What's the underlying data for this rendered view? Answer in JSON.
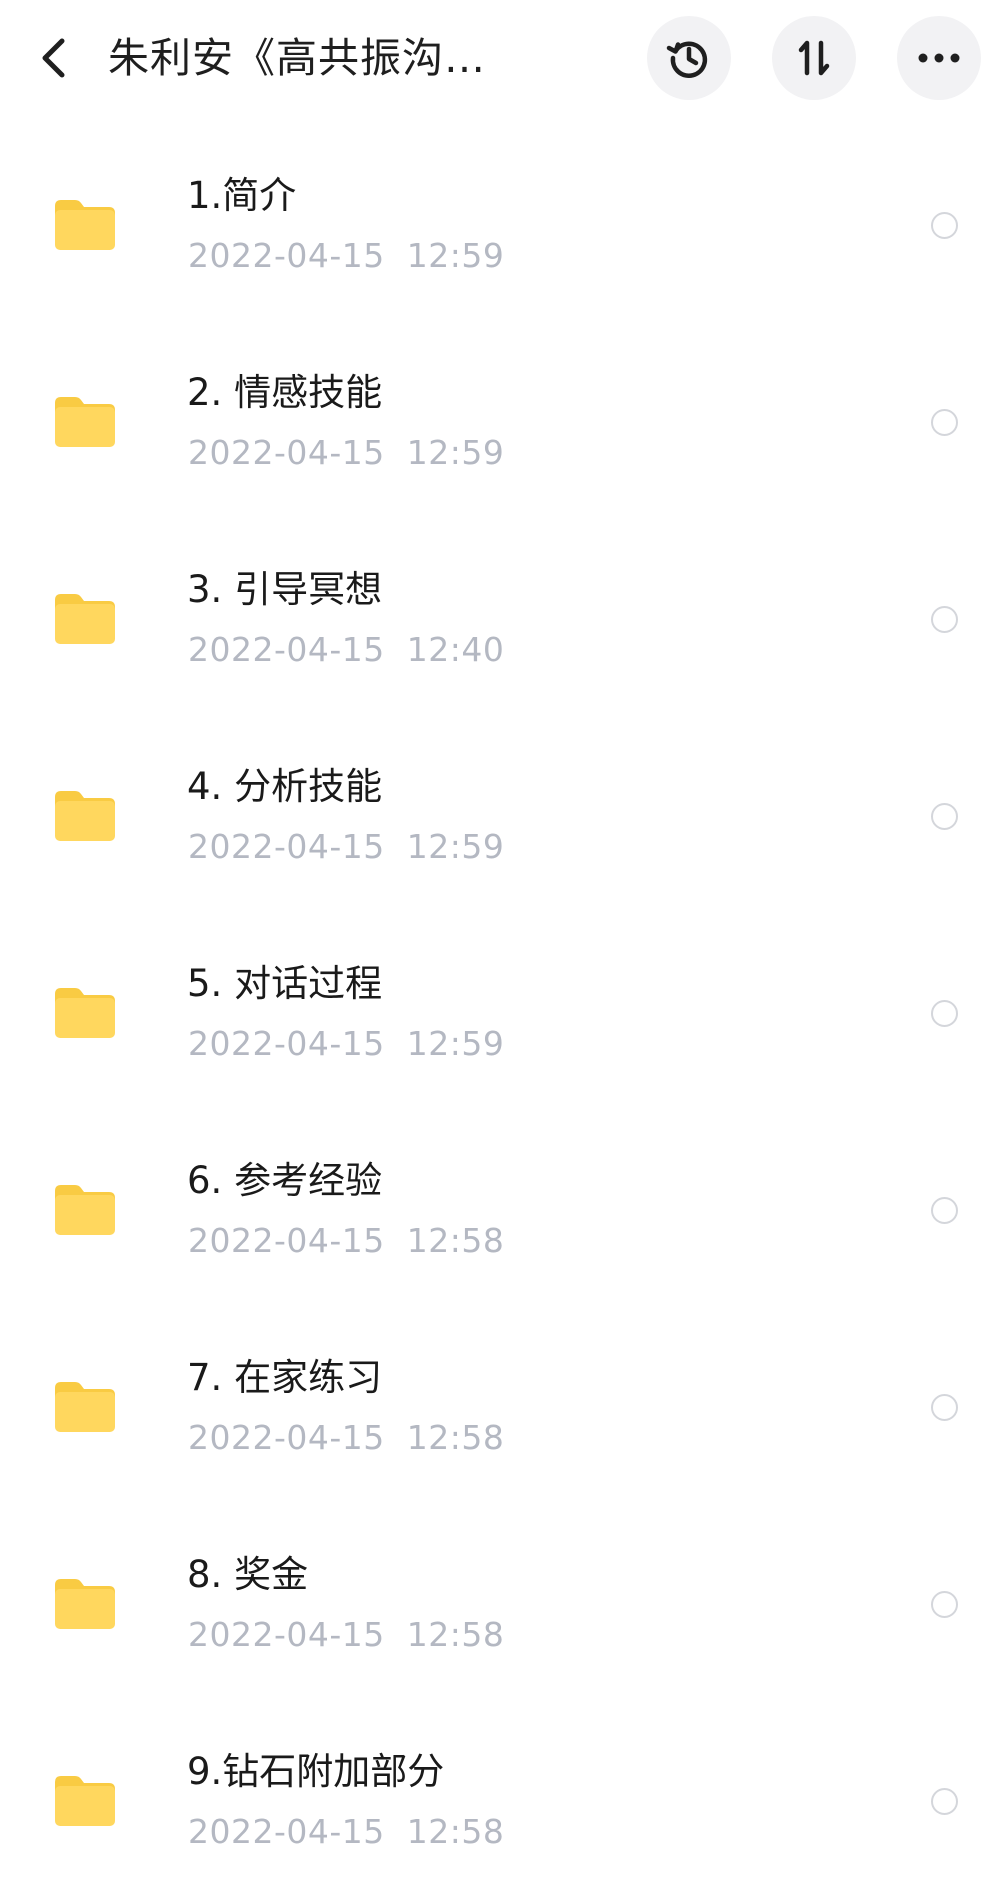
{
  "header": {
    "title": "朱利安《高共振沟…",
    "icons": {
      "back": "chevron-left-icon",
      "history": "history-icon",
      "sort": "sort-icon",
      "more": "more-horizontal-icon"
    }
  },
  "colors": {
    "folder": "#FFD75E",
    "folder_tab": "#F9CB43",
    "date_text": "#B4B8C2",
    "button_bg": "#F2F2F4",
    "radio_border": "#D4D6DB"
  },
  "files": [
    {
      "name": "1.简介",
      "date": "2022-04-15  12:59",
      "icon": "folder-icon"
    },
    {
      "name": "2. 情感技能",
      "date": "2022-04-15  12:59",
      "icon": "folder-icon"
    },
    {
      "name": "3. 引导冥想",
      "date": "2022-04-15  12:40",
      "icon": "folder-icon"
    },
    {
      "name": "4. 分析技能",
      "date": "2022-04-15  12:59",
      "icon": "folder-icon"
    },
    {
      "name": "5. 对话过程",
      "date": "2022-04-15  12:59",
      "icon": "folder-icon"
    },
    {
      "name": "6. 参考经验",
      "date": "2022-04-15  12:58",
      "icon": "folder-icon"
    },
    {
      "name": "7. 在家练习",
      "date": "2022-04-15  12:58",
      "icon": "folder-icon"
    },
    {
      "name": "8. 奖金",
      "date": "2022-04-15  12:58",
      "icon": "folder-icon"
    },
    {
      "name": "9.钻石附加部分",
      "date": "2022-04-15  12:58",
      "icon": "folder-icon"
    }
  ]
}
